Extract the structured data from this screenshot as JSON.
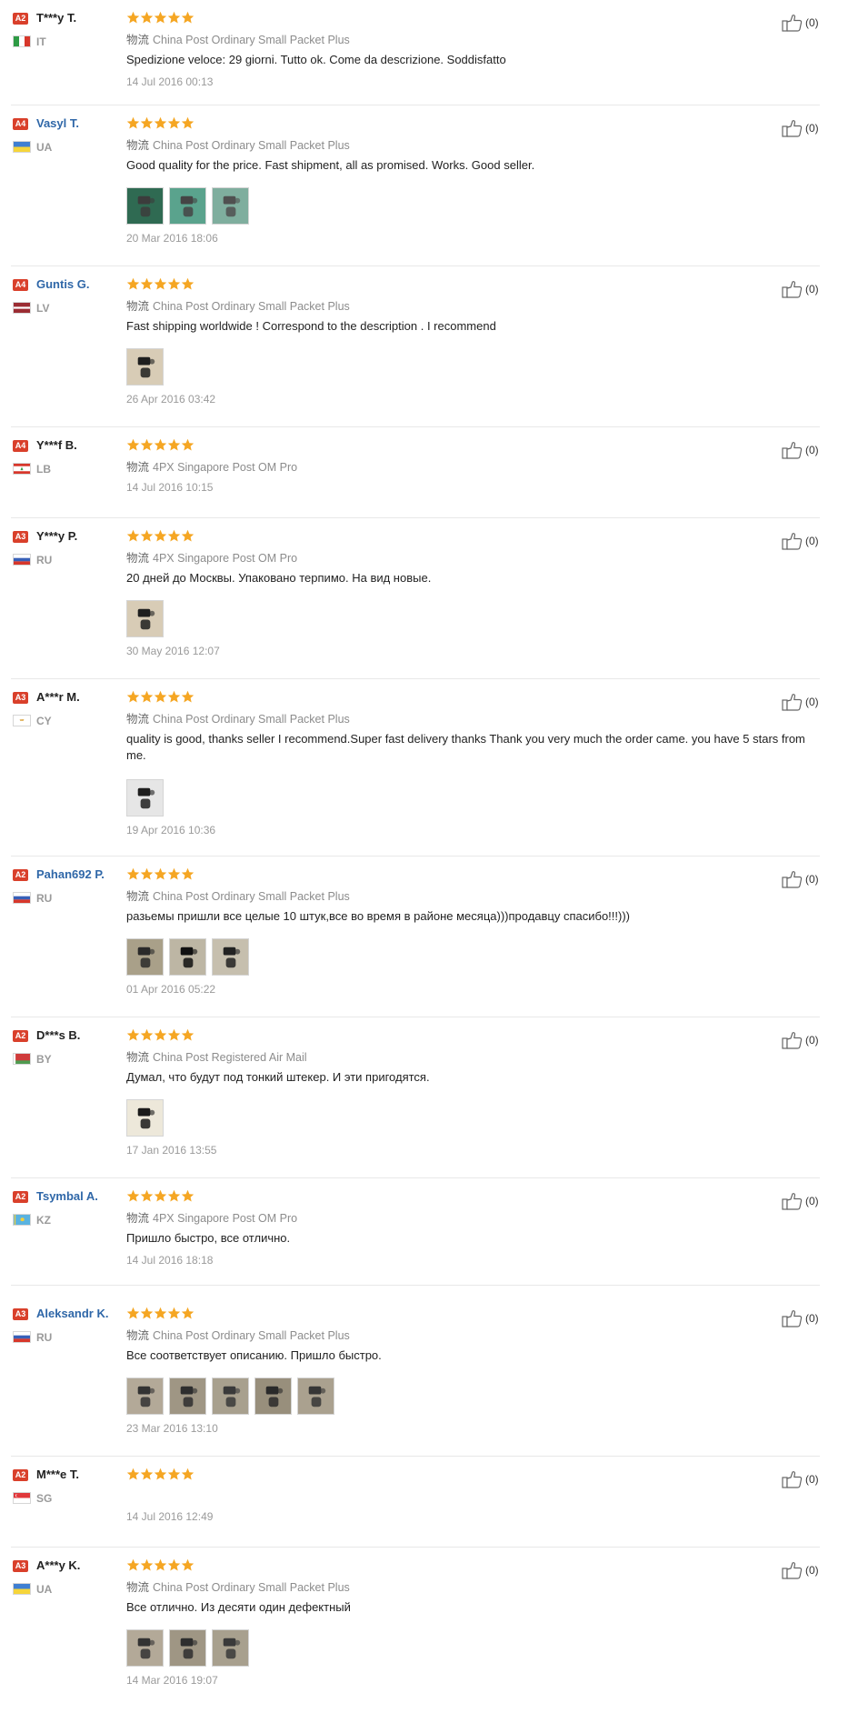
{
  "logistics_label": "物流",
  "colors": {
    "badge": "#d9402b",
    "star": "#f5a623",
    "link": "#2f67a8",
    "muted": "#9a9a9a"
  },
  "icons": {
    "rating": "star-icon",
    "helpful": "thumbs-up-icon",
    "country": "flag-icon"
  },
  "reviews": [
    {
      "badge": "A2",
      "name": "T***y T.",
      "name_is_link": false,
      "country": "IT",
      "rating": 5,
      "logistics": "China Post Ordinary Small Packet Plus",
      "text": "Spedizione veloce: 29 giorni. Tutto ok. Come da descrizione. Soddisfatto",
      "photos": [],
      "date": "14 Jul 2016 00:13",
      "helpful": "(0)"
    },
    {
      "badge": "A4",
      "name": "Vasyl T.",
      "name_is_link": true,
      "country": "UA",
      "rating": 5,
      "logistics": "China Post Ordinary Small Packet Plus",
      "text": "Good quality for the price. Fast shipment, all as promised. Works. Good seller.",
      "photos": [
        "photo-circuit-board-1",
        "photo-circuit-board-2",
        "photo-circuit-board-3"
      ],
      "date": "20 Mar 2016 18:06",
      "helpful": "(0)"
    },
    {
      "badge": "A4",
      "name": "Guntis G.",
      "name_is_link": true,
      "country": "LV",
      "rating": 5,
      "logistics": "China Post Ordinary Small Packet Plus",
      "text": "Fast shipping worldwide ! Correspond to the description . I recommend",
      "photos": [
        "photo-connectors"
      ],
      "date": "26 Apr 2016 03:42",
      "helpful": "(0)"
    },
    {
      "badge": "A4",
      "name": "Y***f B.",
      "name_is_link": false,
      "country": "LB",
      "rating": 5,
      "logistics": "4PX Singapore Post OM Pro",
      "text": "",
      "photos": [],
      "date": "14 Jul 2016 10:15",
      "helpful": "(0)"
    },
    {
      "badge": "A3",
      "name": "Y***y P.",
      "name_is_link": false,
      "country": "RU",
      "rating": 5,
      "logistics": "4PX Singapore Post OM Pro",
      "text": "20 дней до Москвы. Упаковано терпимо. На вид новые.",
      "photos": [
        "photo-connectors"
      ],
      "date": "30 May 2016 12:07",
      "helpful": "(0)"
    },
    {
      "badge": "A3",
      "name": "A***r M.",
      "name_is_link": false,
      "country": "CY",
      "rating": 5,
      "logistics": "China Post Ordinary Small Packet Plus",
      "text": "quality is good, thanks seller I recommend.Super fast delivery thanks Thank you very much the order came. you have 5 stars from me.",
      "photos": [
        "photo-connectors-pair"
      ],
      "date": "19 Apr 2016 10:36",
      "helpful": "(0)"
    },
    {
      "badge": "A2",
      "name": "Pahan692 P.",
      "name_is_link": true,
      "country": "RU",
      "rating": 5,
      "logistics": "China Post Ordinary Small Packet Plus",
      "text": "разьемы пришли все целые 10 штук,все во время в районе месяца)))продавцу спасибо!!!)))",
      "photos": [
        "photo-connector-ring-1",
        "photo-connector-ring-2",
        "photo-connector-ring-3"
      ],
      "date": "01 Apr 2016 05:22",
      "helpful": "(0)"
    },
    {
      "badge": "A2",
      "name": "D***s B.",
      "name_is_link": false,
      "country": "BY",
      "rating": 5,
      "logistics": "China Post Registered Air Mail",
      "text": "Думал, что будут под тонкий штекер. И эти пригодятся.",
      "photos": [
        "photo-dark-phone"
      ],
      "date": "17 Jan 2016 13:55",
      "helpful": "(0)"
    },
    {
      "badge": "A2",
      "name": "Tsymbal A.",
      "name_is_link": true,
      "country": "KZ",
      "rating": 5,
      "logistics": "4PX Singapore Post OM Pro",
      "text": "Пришло быстро, все отлично.",
      "photos": [],
      "date": "14 Jul 2016 18:18",
      "helpful": "(0)"
    },
    {
      "badge": "A3",
      "name": "Aleksandr K.",
      "name_is_link": true,
      "country": "RU",
      "rating": 5,
      "logistics": "China Post Ordinary Small Packet Plus",
      "text": "Все соответствует описанию. Пришло быстро.",
      "photos": [
        "photo-jack-1",
        "photo-jack-2",
        "photo-jack-3",
        "photo-jack-4",
        "photo-jack-5"
      ],
      "date": "23 Mar 2016 13:10",
      "helpful": "(0)"
    },
    {
      "badge": "A2",
      "name": "M***e T.",
      "name_is_link": false,
      "country": "SG",
      "rating": 5,
      "logistics": "",
      "text": "",
      "photos": [],
      "date": "14 Jul 2016 12:49",
      "helpful": "(0)"
    },
    {
      "badge": "A3",
      "name": "A***y K.",
      "name_is_link": false,
      "country": "UA",
      "rating": 5,
      "logistics": "China Post Ordinary Small Packet Plus",
      "text": "Все отлично. Из десяти один дефектный",
      "photos": [
        "photo-jack-1",
        "photo-jack-2",
        "photo-jack-3"
      ],
      "date": "14 Mar 2016 19:07",
      "helpful": "(0)"
    }
  ]
}
